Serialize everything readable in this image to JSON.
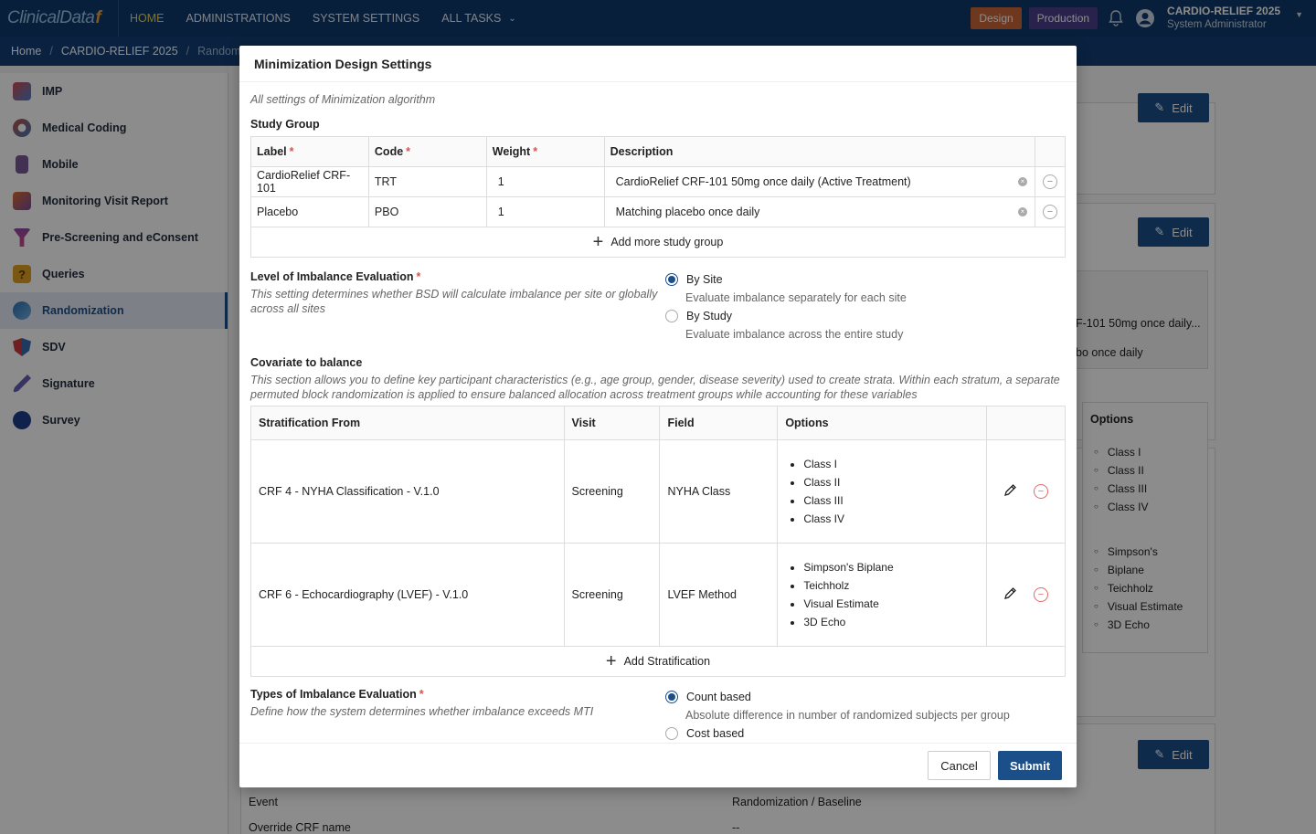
{
  "topbar": {
    "logo_text": "ClinicalData",
    "logo_mark": "f",
    "nav": [
      "HOME",
      "ADMINISTRATIONS",
      "SYSTEM SETTINGS",
      "ALL TASKS"
    ],
    "badge_design": "Design",
    "badge_production": "Production",
    "study_name": "CARDIO-RELIEF 2025",
    "user_role": "System Administrator",
    "colors": {
      "bar": "#0e3a6b",
      "active_nav": "#f0d34a",
      "design": "#c8663a",
      "production": "#4a3f8c"
    }
  },
  "breadcrumb": [
    "Home",
    "CARDIO-RELIEF 2025",
    "Randomiza"
  ],
  "sidebar": {
    "items": [
      {
        "label": "IMP",
        "icon": "cube-icon",
        "color": "#d24b4b"
      },
      {
        "label": "Medical Coding",
        "icon": "nodes-icon",
        "color": "#c0513f"
      },
      {
        "label": "Mobile",
        "icon": "mobile-icon",
        "color": "#7a5a9a"
      },
      {
        "label": "Monitoring Visit Report",
        "icon": "report-icon",
        "color": "#d86b2a"
      },
      {
        "label": "Pre-Screening and eConsent",
        "icon": "funnel-icon",
        "color": "#8e4aa3"
      },
      {
        "label": "Queries",
        "icon": "question-icon",
        "color": "#e0a020"
      },
      {
        "label": "Randomization",
        "icon": "randomize-icon",
        "color": "#2d6fb0"
      },
      {
        "label": "SDV",
        "icon": "shield-icon",
        "color": "#c83a3a"
      },
      {
        "label": "Signature",
        "icon": "pen-icon",
        "color": "#2f63a8"
      },
      {
        "label": "Survey",
        "icon": "survey-icon",
        "color": "#1e3f8a"
      }
    ],
    "active_index": 6
  },
  "background": {
    "edit_label": "Edit",
    "row1": "F-101 50mg once daily...",
    "row2": "bo once daily",
    "options_header": "Options",
    "options1": [
      "Class I",
      "Class II",
      "Class III",
      "Class IV"
    ],
    "options2": [
      "Simpson's",
      "Biplane",
      "Teichholz",
      "Visual Estimate",
      "3D Echo"
    ],
    "event_label": "Event",
    "event_value": "Randomization / Baseline",
    "override_label": "Override CRF name",
    "override_value": "--"
  },
  "modal": {
    "title": "Minimization Design Settings",
    "subtitle": "All settings of Minimization algorithm",
    "study_group": {
      "title": "Study Group",
      "headers": [
        "Label",
        "Code",
        "Weight",
        "Description"
      ],
      "rows": [
        {
          "label": "CardioRelief CRF-101",
          "code": "TRT",
          "weight": "1",
          "description": "CardioRelief CRF-101 50mg once daily (Active Treatment)"
        },
        {
          "label": "Placebo",
          "code": "PBO",
          "weight": "1",
          "description": "Matching placebo once daily"
        }
      ],
      "add_label": "Add more study group"
    },
    "imbalance_level": {
      "title": "Level of Imbalance Evaluation",
      "description": "This setting determines whether BSD will calculate imbalance per site or globally across all sites",
      "options": [
        {
          "label": "By Site",
          "desc": "Evaluate imbalance separately for each site",
          "selected": true
        },
        {
          "label": "By Study",
          "desc": "Evaluate imbalance across the entire study",
          "selected": false
        }
      ]
    },
    "covariate": {
      "title": "Covariate to balance",
      "description": "This section allows you to define key participant characteristics (e.g., age group, gender, disease severity) used to create strata. Within each stratum, a separate permuted block randomization is applied to ensure balanced allocation across treatment groups while accounting for these variables",
      "headers": [
        "Stratification From",
        "Visit",
        "Field",
        "Options"
      ],
      "rows": [
        {
          "from": "CRF 4 - NYHA Classification - V.1.0",
          "visit": "Screening",
          "field": "NYHA Class",
          "options": [
            "Class I",
            "Class II",
            "Class III",
            "Class IV"
          ]
        },
        {
          "from": "CRF 6 - Echocardiography (LVEF) - V.1.0",
          "visit": "Screening",
          "field": "LVEF Method",
          "options": [
            "Simpson's Biplane",
            "Teichholz",
            "Visual Estimate",
            "3D Echo"
          ]
        }
      ],
      "add_label": "Add Stratification"
    },
    "imbalance_type": {
      "title": "Types of Imbalance Evaluation",
      "description": "Define how the system determines whether imbalance exceeds MTI",
      "options": [
        {
          "label": "Count based",
          "desc": "Absolute difference in number of randomized subjects per group",
          "selected": true
        },
        {
          "label": "Cost based",
          "selected": false
        }
      ]
    },
    "cancel_label": "Cancel",
    "submit_label": "Submit"
  }
}
